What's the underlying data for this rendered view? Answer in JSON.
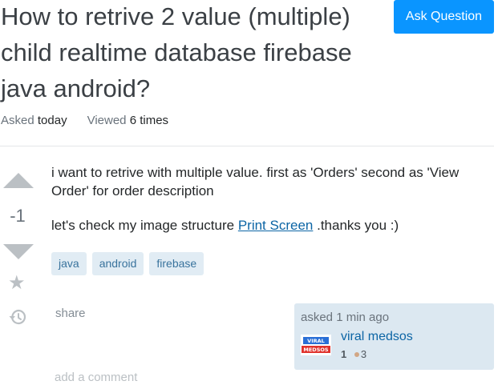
{
  "question": {
    "title": "How to retrive 2 value (multiple) child realtime database firebase java android?",
    "ask_button": "Ask Question",
    "asked_label": "Asked",
    "asked_value": "today",
    "viewed_label": "Viewed",
    "viewed_value": "6 times"
  },
  "vote": {
    "count": "-1"
  },
  "body": {
    "paragraph1": "i want to retrive with multiple value. first as 'Orders' second as 'View Order' for order description",
    "paragraph2_prefix": "let's check my image structure ",
    "paragraph2_link": "Print Screen",
    "paragraph2_suffix": " .thanks you :)"
  },
  "tags": [
    "java",
    "android",
    "firebase"
  ],
  "actions": {
    "share": "share",
    "add_comment": "add a comment"
  },
  "owner": {
    "asked_time": "asked 1 min ago",
    "name": "viral medsos",
    "reputation": "1",
    "bronze_badges": "3",
    "avatar_text_top": "VIRAL",
    "avatar_text_bottom": "MEDSOS"
  },
  "colors": {
    "accent": "#0a95ff",
    "link": "#0c65a5",
    "tag_bg": "#e1ecf4",
    "tag_fg": "#39739d",
    "owner_bg": "#dce8f1",
    "vote_arrow": "#bbc0c4"
  },
  "icons": [
    "upvote-arrow-icon",
    "downvote-arrow-icon",
    "star-icon",
    "history-icon",
    "bronze-badge-icon"
  ]
}
